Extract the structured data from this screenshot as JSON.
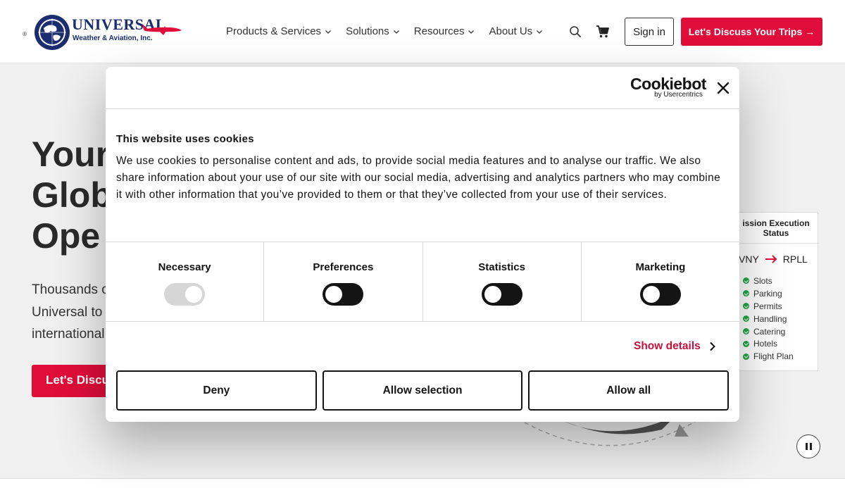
{
  "header": {
    "logo": {
      "name": "UNIVERSAL",
      "subtitle": "Weather & Aviation, Inc.",
      "registered": "®"
    },
    "nav": [
      {
        "label": "Products & Services"
      },
      {
        "label": "Solutions"
      },
      {
        "label": "Resources"
      },
      {
        "label": "About Us"
      }
    ],
    "search_icon": "search-icon",
    "cart_icon": "cart-icon",
    "signin_label": "Sign in",
    "discuss_label": "Let's Discuss Your Trips",
    "discuss_arrow": "→"
  },
  "hero": {
    "title_lines": [
      "Your",
      "Glob",
      "Ope"
    ],
    "text_lines": [
      "Thousands o",
      "Universal to",
      "international"
    ],
    "cta_label": "Let's Discu",
    "mission_card": {
      "title": "ission Execution Status",
      "route_from": "VNY",
      "route_to": "RPLL",
      "items": [
        "Slots",
        "Parking",
        "Permits",
        "Handling",
        "Catering",
        "Hotels",
        "Flight Plan"
      ]
    }
  },
  "cookie_dialog": {
    "brand": "Cookiebot",
    "brand_sub": "by Usercentrics",
    "title": "This website uses cookies",
    "text": "We use cookies to personalise content and ads, to provide social media features and to analyse our traffic. We also share information about your use of our site with our social media, advertising and analytics partners who may combine it with other information that you’ve provided to them or that they’ve collected from your use of their services.",
    "toggles": [
      {
        "label": "Necessary",
        "state": "on-disabled"
      },
      {
        "label": "Preferences",
        "state": "off"
      },
      {
        "label": "Statistics",
        "state": "off"
      },
      {
        "label": "Marketing",
        "state": "off"
      }
    ],
    "show_details_label": "Show details",
    "buttons": {
      "deny": "Deny",
      "allow_selection": "Allow selection",
      "allow_all": "Allow all"
    }
  },
  "colors": {
    "brand_red": "#e00d3a",
    "brand_navy": "#1b2d6e",
    "cookiebot_link": "#c8103a",
    "status_green": "#22a848"
  }
}
